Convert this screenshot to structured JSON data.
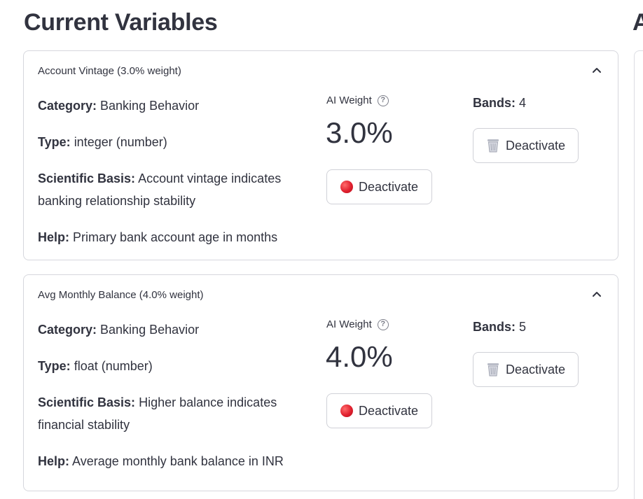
{
  "page_title": "Current Variables",
  "right_title_fragment": "A",
  "variables": [
    {
      "header": "Account Vintage (3.0% weight)",
      "category_label": "Category:",
      "category": "Banking Behavior",
      "type_label": "Type:",
      "type": "integer (number)",
      "basis_label": "Scientific Basis:",
      "basis": "Account vintage indicates banking relationship stability",
      "help_label": "Help:",
      "help": "Primary bank account age in months",
      "metric_label": "AI Weight",
      "metric_value": "3.0%",
      "deactivate_label": "Deactivate",
      "bands_label": "Bands:",
      "bands": "4",
      "trash_deactivate_label": "Deactivate"
    },
    {
      "header": "Avg Monthly Balance (4.0% weight)",
      "category_label": "Category:",
      "category": "Banking Behavior",
      "type_label": "Type:",
      "type": "float (number)",
      "basis_label": "Scientific Basis:",
      "basis": "Higher balance indicates financial stability",
      "help_label": "Help:",
      "help": "Average monthly bank balance in INR",
      "metric_label": "AI Weight",
      "metric_value": "4.0%",
      "deactivate_label": "Deactivate",
      "bands_label": "Bands:",
      "bands": "5",
      "trash_deactivate_label": "Deactivate"
    }
  ],
  "icons": {
    "chevron": "chevron-up-icon",
    "help": "help-circle-icon",
    "red": "red-circle-icon",
    "trash": "wastebasket-icon"
  },
  "colors": {
    "text": "#31333f",
    "border": "#d6d7dd",
    "red": "#e0202e"
  }
}
